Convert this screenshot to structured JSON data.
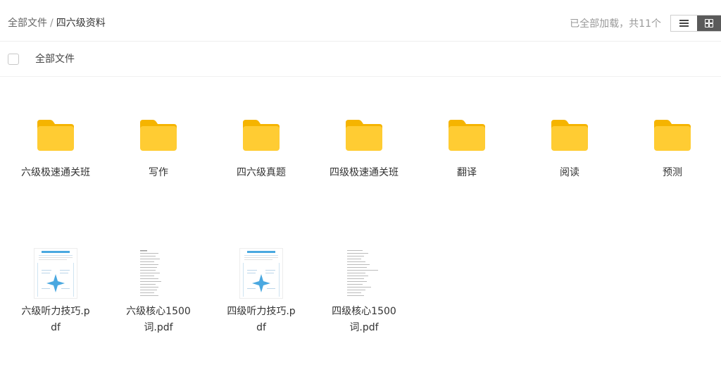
{
  "breadcrumb": {
    "root": "全部文件",
    "separator": "/",
    "current": "四六级资料"
  },
  "status": "已全部加载，共11个",
  "view_toggle": {
    "list_icon": "list-icon",
    "grid_icon": "grid-icon",
    "active": "grid"
  },
  "select_all": {
    "label": "全部文件"
  },
  "folders": [
    {
      "name": "六级极速通关班"
    },
    {
      "name": "写作"
    },
    {
      "name": "四六级真题"
    },
    {
      "name": "四级极速通关班"
    },
    {
      "name": "翻译"
    },
    {
      "name": "阅读"
    },
    {
      "name": "预测"
    }
  ],
  "files": [
    {
      "name": "六级听力技巧.pdf",
      "line1": "六级听力技巧.p",
      "line2": "df",
      "thumb": "diagram"
    },
    {
      "name": "六级核心1500词.pdf",
      "line1": "六级核心1500",
      "line2": "词.pdf",
      "thumb": "wordlist"
    },
    {
      "name": "四级听力技巧.pdf",
      "line1": "四级听力技巧.p",
      "line2": "df",
      "thumb": "diagram"
    },
    {
      "name": "四级核心1500词.pdf",
      "line1": "四级核心1500",
      "line2": "词.pdf",
      "thumb": "wordlist"
    }
  ],
  "colors": {
    "folder_body": "#ffcc33",
    "folder_tab": "#f5b400",
    "active_toggle": "#5a5a5a",
    "thumb_accent": "#4aa8e0"
  }
}
